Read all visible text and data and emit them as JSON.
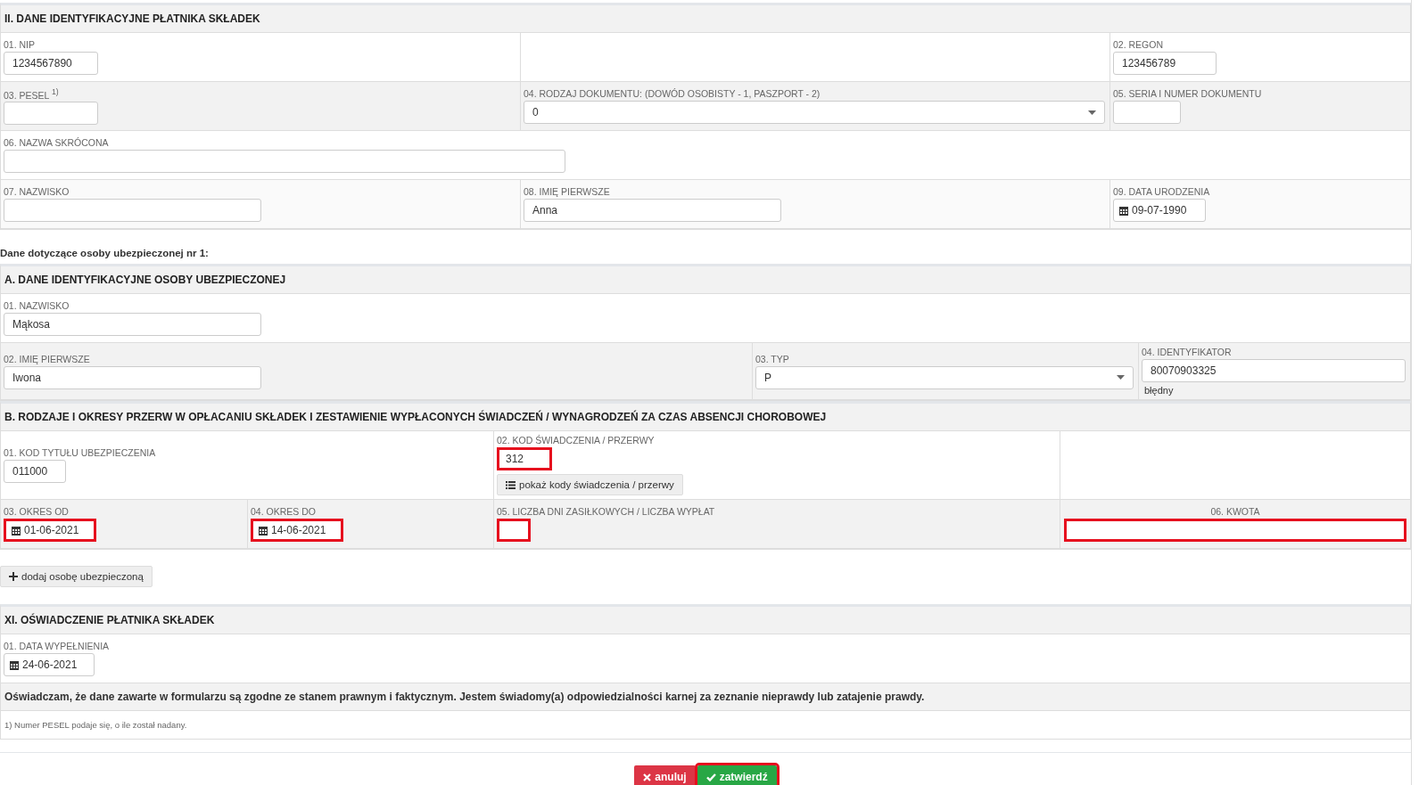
{
  "sections": [
    {
      "title": "II. DANE IDENTYFIKACYJNE PŁATNIKA SKŁADEK",
      "rows": [
        [
          {
            "kind": "text",
            "label": "01. NIP",
            "value": "1234567890",
            "highlighted": false
          },
          {
            "kind": "empty"
          },
          {
            "kind": "text",
            "label": "02. REGON",
            "value": "123456789",
            "highlighted": false
          }
        ],
        [
          {
            "kind": "text",
            "label": "03. PESEL $^{1)}$",
            "highlighted": false
          },
          {
            "kind": "select",
            "label": "04. RODZAJ DOKUMENTU: (DOWÓD OSOBISTY - 1, PASZPORT - 2)",
            "value": "0",
            "highlighted": false
          },
          {
            "kind": "text",
            "label": "05. SERIA I NUMER DOKUMENTU",
            "highlighted": false
          }
        ],
        [
          {
            "kind": "text",
            "label": "06. NAZWA SKRÓCONA",
            "highlighted": false
          }
        ],
        [
          {
            "kind": "text",
            "label": "07. NAZWISKO",
            "highlighted": false
          },
          {
            "kind": "text",
            "label": "08. IMIĘ PIERWSZE",
            "value": "Anna",
            "highlighted": false
          },
          {
            "kind": "date",
            "label": "09. DATA URODZENIA",
            "value": "09-07-1990",
            "highlighted": false
          }
        ]
      ]
    },
    {
      "intro": "Dane dotyczące osoby ubezpieczonej nr 1:",
      "title": "A. DANE IDENTYFIKACYJNE OSOBY UBEZPIECZONEJ",
      "rows": [
        [
          {
            "kind": "text",
            "label": "01. NAZWISKO",
            "value": "Mąkosa",
            "highlighted": false
          }
        ],
        [
          {
            "kind": "text",
            "label": "02. IMIĘ PIERWSZE",
            "value": "Iwona",
            "highlighted": false
          },
          {
            "kind": "select",
            "label": "03. TYP",
            "value": "P",
            "highlighted": false
          },
          {
            "kind": "text",
            "label": "04. IDENTYFIKATOR",
            "value": "80070903325",
            "note": "błędny",
            "highlighted": false
          }
        ]
      ]
    },
    {
      "title": "B. RODZAJE I OKRESY PRZERW W OPŁACANIU SKŁADEK I ZESTAWIENIE WYPŁACONYCH ŚWIADCZEŃ / WYNAGRODZEŃ ZA CZAS ABSENCJI CHOROBOWEJ",
      "rows": [
        [
          {
            "kind": "text",
            "label": "01. KOD TYTUŁU UBEZPIECZENIA",
            "value": "011000",
            "highlighted": false
          },
          {
            "kind": "empty"
          },
          {
            "kind": "text",
            "label": "02. KOD ŚWIADCZENIA / PRZERWY",
            "value": "312",
            "button": "pokaż kody świadczenia / przerwy",
            "highlighted": true
          },
          {
            "kind": "empty"
          }
        ],
        [
          {
            "kind": "date",
            "label": "03. OKRES OD",
            "value": "01-06-2021",
            "highlighted": true
          },
          {
            "kind": "date",
            "label": "04. OKRES DO",
            "value": "14-06-2021",
            "highlighted": true
          },
          {
            "kind": "text",
            "label": "05. LICZBA DNI ZASIŁKOWYCH / LICZBA WYPŁAT",
            "highlighted": true
          },
          {
            "kind": "text",
            "label": "06. KWOTA",
            "highlighted": true
          }
        ]
      ],
      "add_button": "dodaj osobę ubezpieczoną"
    },
    {
      "title": "XI. OŚWIADCZENIE PŁATNIKA SKŁADEK",
      "rows": [
        [
          {
            "kind": "date",
            "label": "01. DATA WYPEŁNIENIA",
            "value": "24-06-2021",
            "highlighted": false
          }
        ]
      ],
      "declaration": "Oświadczam, że dane zawarte w formularzu są zgodne ze stanem prawnym i faktycznym. Jestem świadomy(a) odpowiedzialności karnej za zeznanie nieprawdy lub zatajenie prawdy.",
      "footnote": "1) Numer PESEL podaje się, o ile został nadany."
    }
  ],
  "actions": [
    {
      "kind": "cancel",
      "label": "anuluj",
      "highlighted": false
    },
    {
      "kind": "confirm",
      "label": "zatwierdź",
      "highlighted": true
    }
  ]
}
